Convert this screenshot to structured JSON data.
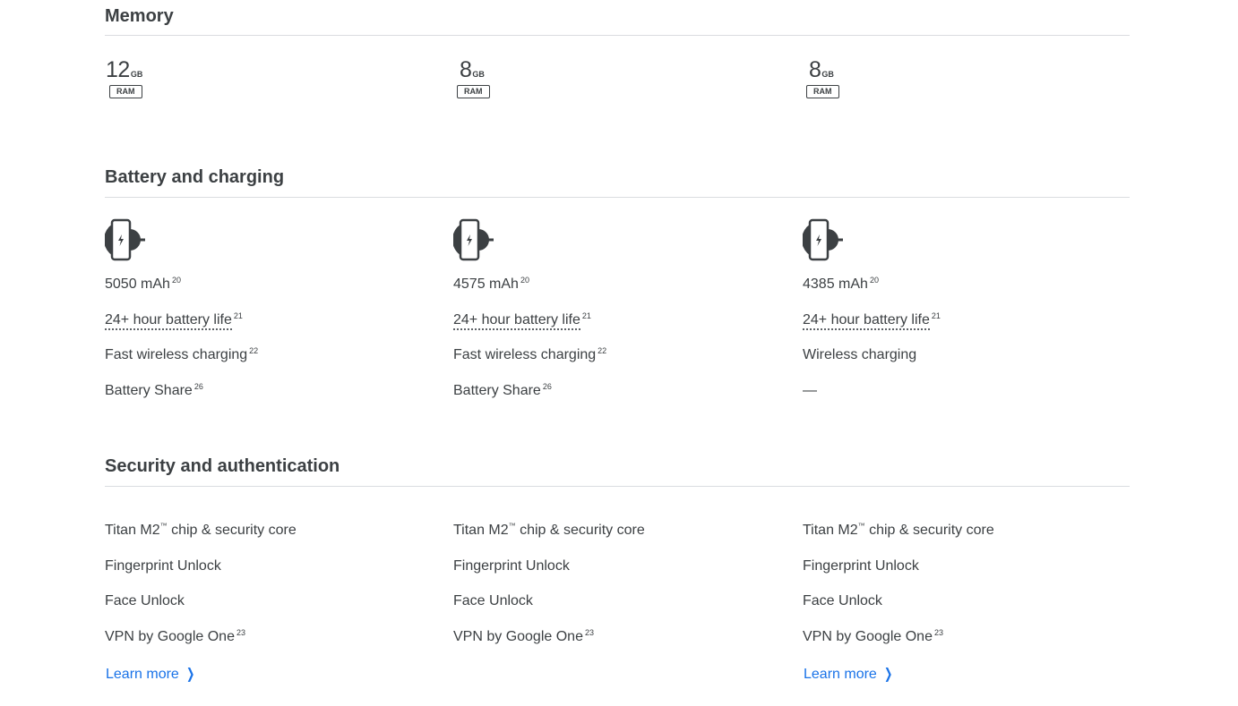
{
  "memory": {
    "title": "Memory",
    "columns": [
      {
        "amount": "12",
        "unit": "GB",
        "badge": "RAM"
      },
      {
        "amount": "8",
        "unit": "GB",
        "badge": "RAM"
      },
      {
        "amount": "8",
        "unit": "GB",
        "badge": "RAM"
      }
    ]
  },
  "battery": {
    "title": "Battery and charging",
    "icon": "wireless-charging-phone-icon",
    "columns": [
      {
        "capacity": "5050 mAh",
        "capacity_note": "20",
        "life": "24+ hour battery life",
        "life_note": "21",
        "charging": "Fast wireless charging",
        "charging_note": "22",
        "share": "Battery Share",
        "share_note": "26"
      },
      {
        "capacity": "4575 mAh",
        "capacity_note": "20",
        "life": "24+ hour battery life",
        "life_note": "21",
        "charging": "Fast wireless charging",
        "charging_note": "22",
        "share": "Battery Share",
        "share_note": "26"
      },
      {
        "capacity": "4385 mAh",
        "capacity_note": "20",
        "life": "24+ hour battery life",
        "life_note": "21",
        "charging": "Wireless charging",
        "charging_note": "",
        "share": "—",
        "share_note": ""
      }
    ]
  },
  "security": {
    "title": "Security and authentication",
    "columns": [
      {
        "chip": "Titan M2",
        "chip_tm": "™",
        "chip_rest": " chip & security core",
        "fingerprint": "Fingerprint Unlock",
        "face": "Face Unlock",
        "vpn": "VPN by Google One",
        "vpn_note": "23",
        "learn_more": "Learn more"
      },
      {
        "chip": "Titan M2",
        "chip_tm": "™",
        "chip_rest": " chip & security core",
        "fingerprint": "Fingerprint Unlock",
        "face": "Face Unlock",
        "vpn": "VPN by Google One",
        "vpn_note": "23",
        "learn_more": ""
      },
      {
        "chip": "Titan M2",
        "chip_tm": "™",
        "chip_rest": " chip & security core",
        "fingerprint": "Fingerprint Unlock",
        "face": "Face Unlock",
        "vpn": "VPN by Google One",
        "vpn_note": "23",
        "learn_more": "Learn more"
      }
    ],
    "chevron_icon": "chevron-right-icon"
  },
  "colors": {
    "text": "#3c4043",
    "link": "#1a73e8",
    "divider": "#dadce0"
  }
}
